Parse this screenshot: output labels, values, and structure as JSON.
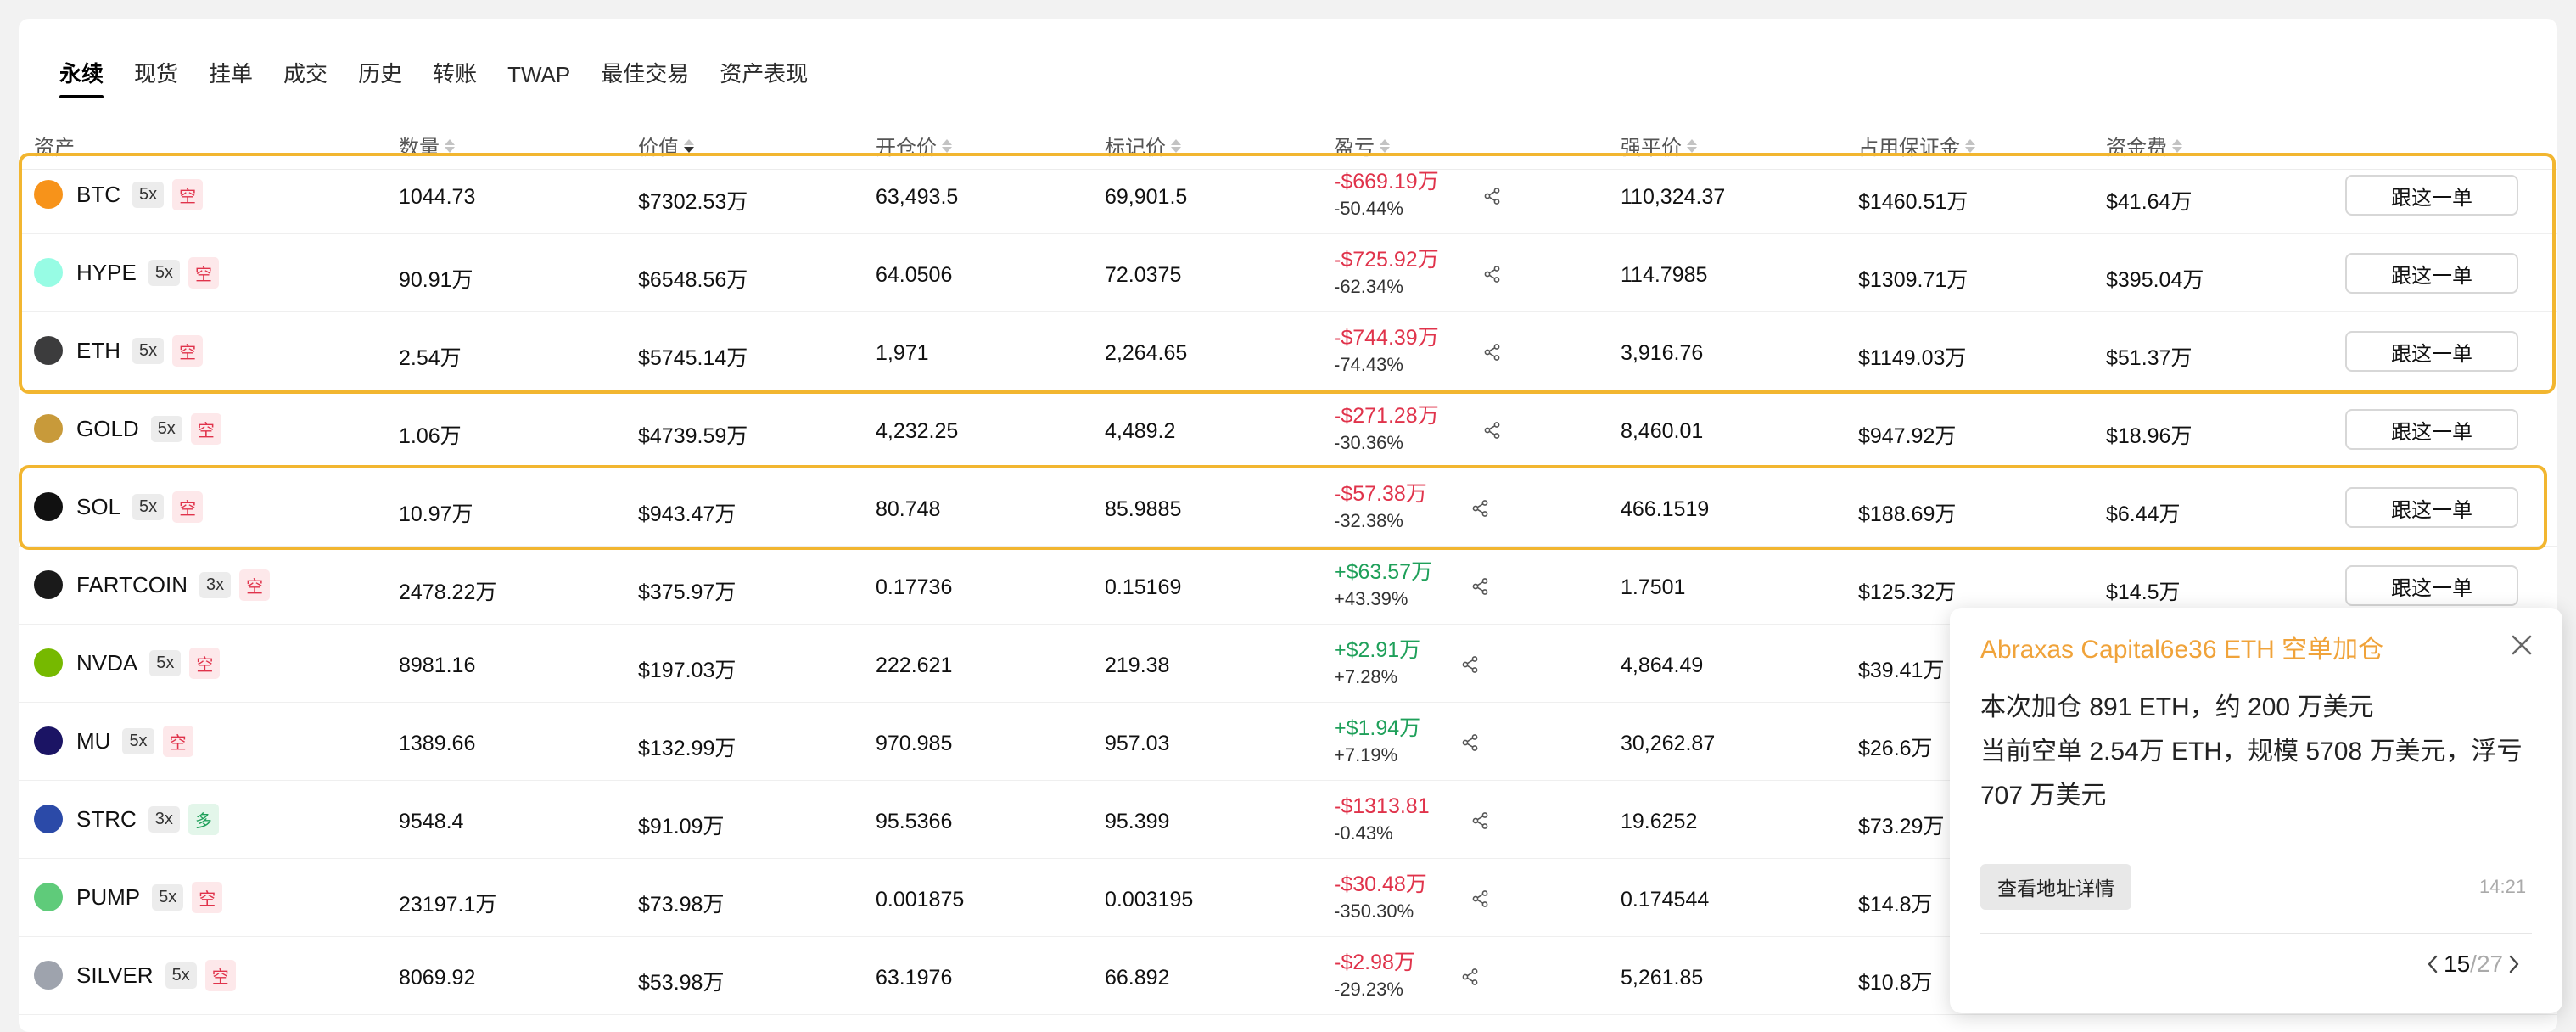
{
  "tabs": [
    "永续",
    "现货",
    "挂单",
    "成交",
    "历史",
    "转账",
    "TWAP",
    "最佳交易",
    "资产表现"
  ],
  "columns": {
    "asset": "资产",
    "qty": "数量",
    "value": "价值",
    "entry": "开仓价",
    "mark": "标记价",
    "pnl": "盈亏",
    "liq": "强平价",
    "margin": "占用保证金",
    "funding": "资金费"
  },
  "follow_label": "跟这一单",
  "rows": [
    {
      "symbol": "BTC",
      "icon": "btc-icon",
      "color": "#f7931a",
      "leverage": "5x",
      "side": "空",
      "side_type": "short",
      "qty": "1044.73",
      "value": "$7302.53万",
      "entry": "63,493.5",
      "mark": "69,901.5",
      "pnl": "-$669.19万",
      "pnl_pct": "-50.44%",
      "pnl_sign": "neg",
      "liq": "110,324.37",
      "margin": "$1460.51万",
      "funding": "$41.64万",
      "highlight": true
    },
    {
      "symbol": "HYPE",
      "icon": "hype-icon",
      "color": "#97fce4",
      "leverage": "5x",
      "side": "空",
      "side_type": "short",
      "qty": "90.91万",
      "value": "$6548.56万",
      "entry": "64.0506",
      "mark": "72.0375",
      "pnl": "-$725.92万",
      "pnl_pct": "-62.34%",
      "pnl_sign": "neg",
      "liq": "114.7985",
      "margin": "$1309.71万",
      "funding": "$395.04万",
      "highlight": true
    },
    {
      "symbol": "ETH",
      "icon": "eth-icon",
      "color": "#3c3c3d",
      "leverage": "5x",
      "side": "空",
      "side_type": "short",
      "qty": "2.54万",
      "value": "$5745.14万",
      "entry": "1,971",
      "mark": "2,264.65",
      "pnl": "-$744.39万",
      "pnl_pct": "-74.43%",
      "pnl_sign": "neg",
      "liq": "3,916.76",
      "margin": "$1149.03万",
      "funding": "$51.37万",
      "highlight": true
    },
    {
      "symbol": "GOLD",
      "icon": "gold-icon",
      "color": "#c89a3a",
      "leverage": "5x",
      "side": "空",
      "side_type": "short",
      "qty": "1.06万",
      "value": "$4739.59万",
      "entry": "4,232.25",
      "mark": "4,489.2",
      "pnl": "-$271.28万",
      "pnl_pct": "-30.36%",
      "pnl_sign": "neg",
      "liq": "8,460.01",
      "margin": "$947.92万",
      "funding": "$18.96万",
      "highlight": false
    },
    {
      "symbol": "SOL",
      "icon": "sol-icon",
      "color": "#111111",
      "leverage": "5x",
      "side": "空",
      "side_type": "short",
      "qty": "10.97万",
      "value": "$943.47万",
      "entry": "80.748",
      "mark": "85.9885",
      "pnl": "-$57.38万",
      "pnl_pct": "-32.38%",
      "pnl_sign": "neg",
      "liq": "466.1519",
      "margin": "$188.69万",
      "funding": "$6.44万",
      "highlight": true
    },
    {
      "symbol": "FARTCOIN",
      "icon": "fartcoin-icon",
      "color": "#1a1a1a",
      "leverage": "3x",
      "side": "空",
      "side_type": "short",
      "qty": "2478.22万",
      "value": "$375.97万",
      "entry": "0.17736",
      "mark": "0.15169",
      "pnl": "+$63.57万",
      "pnl_pct": "+43.39%",
      "pnl_sign": "pos",
      "liq": "1.7501",
      "margin": "$125.32万",
      "funding": "$14.5万",
      "highlight": false
    },
    {
      "symbol": "NVDA",
      "icon": "nvda-icon",
      "color": "#76b900",
      "leverage": "5x",
      "side": "空",
      "side_type": "short",
      "qty": "8981.16",
      "value": "$197.03万",
      "entry": "222.621",
      "mark": "219.38",
      "pnl": "+$2.91万",
      "pnl_pct": "+7.28%",
      "pnl_sign": "pos",
      "liq": "4,864.49",
      "margin": "$39.41万",
      "funding": "",
      "highlight": false
    },
    {
      "symbol": "MU",
      "icon": "mu-icon",
      "color": "#1b1464",
      "leverage": "5x",
      "side": "空",
      "side_type": "short",
      "qty": "1389.66",
      "value": "$132.99万",
      "entry": "970.985",
      "mark": "957.03",
      "pnl": "+$1.94万",
      "pnl_pct": "+7.19%",
      "pnl_sign": "pos",
      "liq": "30,262.87",
      "margin": "$26.6万",
      "funding": "",
      "highlight": false
    },
    {
      "symbol": "STRC",
      "icon": "strc-icon",
      "color": "#2b4aa8",
      "leverage": "3x",
      "side": "多",
      "side_type": "long",
      "qty": "9548.4",
      "value": "$91.09万",
      "entry": "95.5366",
      "mark": "95.399",
      "pnl": "-$1313.81",
      "pnl_pct": "-0.43%",
      "pnl_sign": "neg",
      "liq": "19.6252",
      "margin": "$73.29万",
      "funding": "",
      "highlight": false
    },
    {
      "symbol": "PUMP",
      "icon": "pump-icon",
      "color": "#5fcb7a",
      "leverage": "5x",
      "side": "空",
      "side_type": "short",
      "qty": "23197.1万",
      "value": "$73.98万",
      "entry": "0.001875",
      "mark": "0.003195",
      "pnl": "-$30.48万",
      "pnl_pct": "-350.30%",
      "pnl_sign": "neg",
      "liq": "0.174544",
      "margin": "$14.8万",
      "funding": "",
      "highlight": false
    },
    {
      "symbol": "SILVER",
      "icon": "silver-icon",
      "color": "#9ea3ad",
      "leverage": "5x",
      "side": "空",
      "side_type": "short",
      "qty": "8069.92",
      "value": "$53.98万",
      "entry": "63.1976",
      "mark": "66.892",
      "pnl": "-$2.98万",
      "pnl_pct": "-29.23%",
      "pnl_sign": "neg",
      "liq": "5,261.85",
      "margin": "$10.8万",
      "funding": "",
      "highlight": false
    }
  ],
  "toast": {
    "title": "Abraxas Capital6e36 ETH 空单加仓",
    "line1": "本次加仓 891 ETH，约 200 万美元",
    "line2": "当前空单 2.54万 ETH，规模 5708 万美元，浮亏 707 万美元",
    "button": "查看地址详情",
    "time": "14:21",
    "page_current": "15",
    "page_sep": "/",
    "page_total": "27"
  },
  "colors": {
    "highlight": "#f2b630",
    "negative": "#e0334b",
    "positive": "#1fa05a",
    "toast_title": "#f0a33a"
  }
}
